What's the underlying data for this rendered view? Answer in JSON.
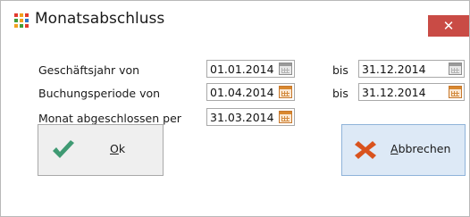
{
  "window": {
    "title": "Monatsabschluss",
    "close_glyph": "✕",
    "app_icon": "colored-grid-icon",
    "close_color": "#c94b45"
  },
  "form": {
    "rows": [
      {
        "label": "Geschäftsjahr von",
        "from": "01.01.2014",
        "separator": "bis",
        "to": "31.12.2014",
        "calendar_active": false
      },
      {
        "label": "Buchungsperiode von",
        "from": "01.04.2014",
        "separator": "bis",
        "to": "31.12.2014",
        "calendar_active": true
      },
      {
        "label": "Monat abgeschlossen per",
        "value": "31.03.2014",
        "calendar_active": true
      }
    ]
  },
  "buttons": {
    "ok": {
      "mnemonic": "O",
      "rest": "k",
      "icon": "checkmark-icon",
      "icon_color": "#3f9a73"
    },
    "cancel": {
      "mnemonic": "A",
      "rest": "bbrechen",
      "icon": "cross-icon",
      "icon_color": "#d9531e"
    }
  }
}
